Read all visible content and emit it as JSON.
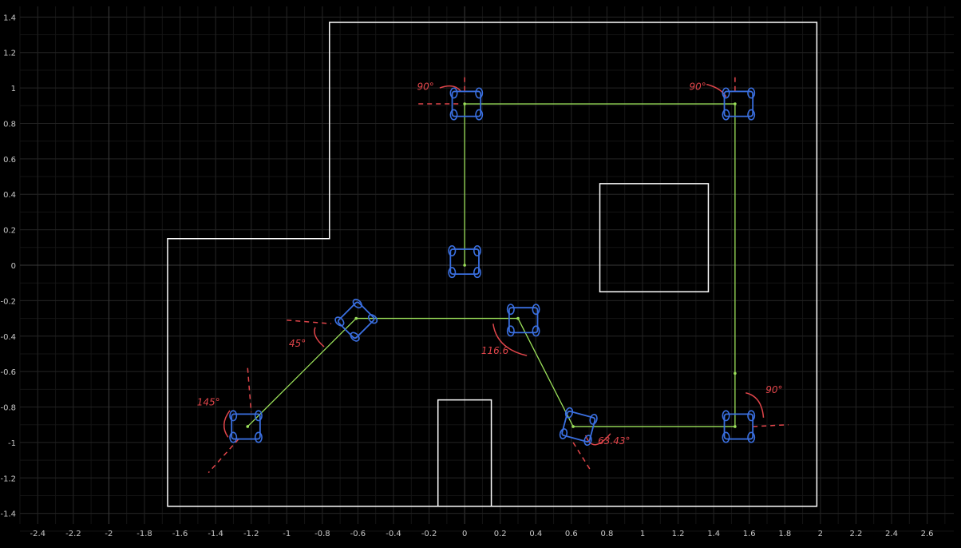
{
  "chart_data": {
    "type": "path-diagram",
    "xlim": [
      -2.5,
      2.75
    ],
    "ylim": [
      -1.46,
      1.46
    ],
    "x_ticks": [
      -2.4,
      -2.2,
      -2,
      -1.8,
      -1.6,
      -1.4,
      -1.2,
      -1,
      -0.8,
      -0.6,
      -0.4,
      -0.2,
      0,
      0.2,
      0.4,
      0.6,
      0.8,
      1,
      1.2,
      1.4,
      1.6,
      1.8,
      2,
      2.2,
      2.4,
      2.6
    ],
    "y_ticks": [
      1.4,
      1.2,
      1,
      0.8,
      0.6,
      0.4,
      0.2,
      0,
      -0.2,
      -0.4,
      -0.6,
      -0.8,
      -1,
      -1.2,
      -1.4
    ],
    "x_tick_labels": [
      "-2.4",
      "-2.2",
      "-2",
      "-1.8",
      "-1.6",
      "-1.4",
      "-1.2",
      "-1",
      "-0.8",
      "-0.6",
      "-0.4",
      "-0.2",
      "0",
      "0.2",
      "0.4",
      "0.6",
      "0.8",
      "1",
      "1.2",
      "1.4",
      "1.6",
      "1.8",
      "2",
      "2.2",
      "2.4",
      "2.6"
    ],
    "y_tick_labels": [
      "1.4",
      "1.2",
      "1",
      "0.8",
      "0.6",
      "0.4",
      "0.2",
      "0",
      "-0.2",
      "-0.4",
      "-0.6",
      "-0.8",
      "-1",
      "-1.2",
      "-1.4"
    ],
    "grid": true,
    "boundary": [
      [
        -1.67,
        -1.36
      ],
      [
        -1.67,
        0.15
      ],
      [
        -0.76,
        0.15
      ],
      [
        -0.76,
        1.37
      ],
      [
        1.98,
        1.37
      ],
      [
        1.98,
        -1.36
      ]
    ],
    "obstacles": [
      [
        [
          0.76,
          -0.15
        ],
        [
          1.37,
          -0.15
        ],
        [
          1.37,
          0.46
        ],
        [
          0.76,
          0.46
        ]
      ],
      [
        [
          -0.15,
          -1.36
        ],
        [
          -0.15,
          -0.76
        ],
        [
          0.15,
          -0.76
        ],
        [
          0.15,
          -1.36
        ]
      ]
    ],
    "path": [
      [
        0,
        0
      ],
      [
        0,
        0.91
      ],
      [
        1.52,
        0.91
      ],
      [
        1.52,
        -0.91
      ],
      [
        0.61,
        -0.91
      ],
      [
        0.3,
        -0.3
      ],
      [
        -0.61,
        -0.3
      ],
      [
        -1.22,
        -0.91
      ]
    ],
    "path_markers": [
      [
        0,
        0
      ],
      [
        0,
        0.91
      ],
      [
        1.52,
        0.91
      ],
      [
        1.52,
        -0.61
      ],
      [
        1.52,
        -0.91
      ],
      [
        0.61,
        -0.91
      ],
      [
        0.3,
        -0.3
      ],
      [
        -0.61,
        -0.3
      ],
      [
        -1.22,
        -0.91
      ]
    ],
    "robots": [
      {
        "x": 0.0,
        "y": 0.02,
        "angle": 0
      },
      {
        "x": 0.01,
        "y": 0.91,
        "angle": 0
      },
      {
        "x": 1.54,
        "y": 0.91,
        "angle": 0
      },
      {
        "x": 1.54,
        "y": -0.91,
        "angle": 0
      },
      {
        "x": 0.64,
        "y": -0.91,
        "angle": -15
      },
      {
        "x": 0.33,
        "y": -0.31,
        "angle": 0
      },
      {
        "x": -0.61,
        "y": -0.31,
        "angle": 45
      },
      {
        "x": -1.23,
        "y": -0.91,
        "angle": 0
      }
    ],
    "annotations": [
      {
        "text": "90°",
        "x": -0.22,
        "y": 0.99
      },
      {
        "text": "90°",
        "x": 1.31,
        "y": 0.99
      },
      {
        "text": "90°",
        "x": 1.74,
        "y": -0.72
      },
      {
        "text": "63.43°",
        "x": 0.84,
        "y": -1.01
      },
      {
        "text": "116.6",
        "x": 0.17,
        "y": -0.5
      },
      {
        "text": "45°",
        "x": -0.94,
        "y": -0.46
      },
      {
        "text": "145°",
        "x": -1.44,
        "y": -0.79
      }
    ],
    "colors": {
      "background": "#000000",
      "grid": "#232323",
      "zero_axis": "#3a3a3a",
      "walls": "#ffffff",
      "path": "#9be05a",
      "robot": "#3a6fe0",
      "annotation": "#e0454a"
    }
  }
}
